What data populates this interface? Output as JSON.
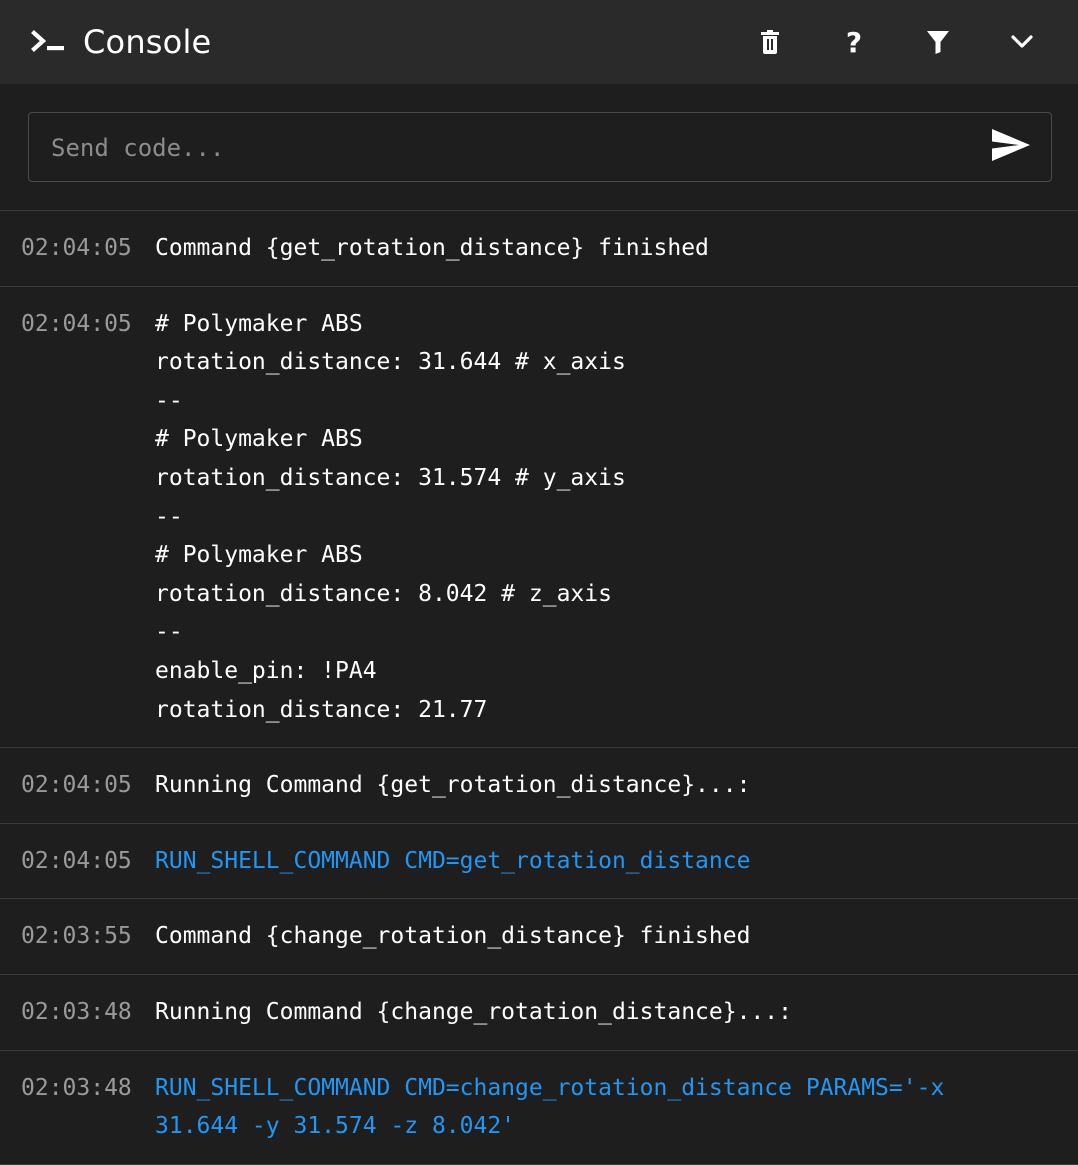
{
  "header": {
    "title": "Console",
    "icons": {
      "console": "terminal-prompt-icon",
      "clear": "trash-icon",
      "help": "help-icon",
      "filter": "filter-icon",
      "collapse": "chevron-down-icon"
    },
    "help_glyph": "?"
  },
  "input": {
    "placeholder": "Send code...",
    "value": "",
    "send_icon": "send-icon"
  },
  "colors": {
    "background": "#1e1e1e",
    "header": "#2a2a2a",
    "command": "#2196f3",
    "timestamp": "#9a9a9a"
  },
  "entries": [
    {
      "time": "02:04:05",
      "type": "response",
      "lines": [
        "Command {get_rotation_distance} finished"
      ]
    },
    {
      "time": "02:04:05",
      "type": "response",
      "lines": [
        "# Polymaker ABS",
        "rotation_distance: 31.644 # x_axis",
        "--",
        "# Polymaker ABS",
        "rotation_distance: 31.574 # y_axis",
        "--",
        "# Polymaker ABS",
        "rotation_distance: 8.042 # z_axis",
        "--",
        "enable_pin: !PA4",
        "rotation_distance: 21.77"
      ]
    },
    {
      "time": "02:04:05",
      "type": "response",
      "lines": [
        "Running Command {get_rotation_distance}...:"
      ]
    },
    {
      "time": "02:04:05",
      "type": "command",
      "lines": [
        "RUN_SHELL_COMMAND CMD=get_rotation_distance"
      ]
    },
    {
      "time": "02:03:55",
      "type": "response",
      "lines": [
        "Command {change_rotation_distance} finished"
      ]
    },
    {
      "time": "02:03:48",
      "type": "response",
      "lines": [
        "Running Command {change_rotation_distance}...:"
      ]
    },
    {
      "time": "02:03:48",
      "type": "command",
      "lines": [
        "RUN_SHELL_COMMAND CMD=change_rotation_distance PARAMS='-x",
        "31.644 -y 31.574 -z 8.042'"
      ]
    }
  ]
}
